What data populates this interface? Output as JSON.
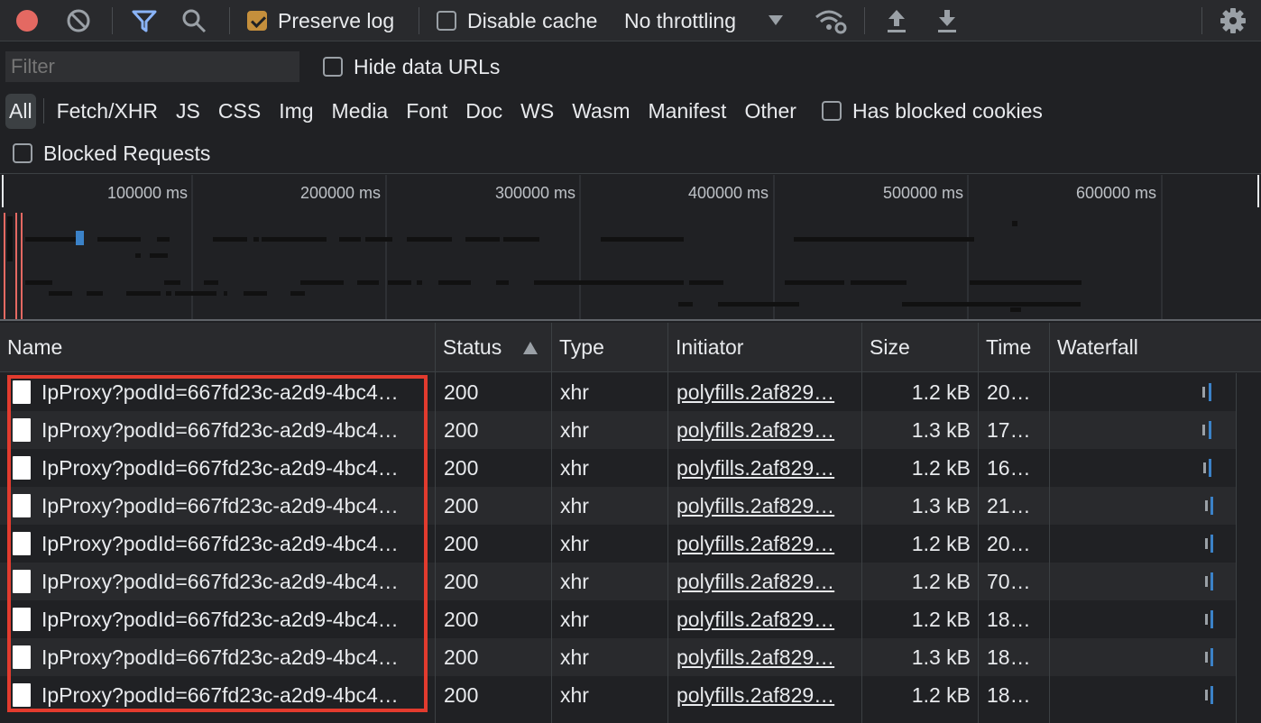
{
  "toolbar": {
    "preserve_log": "Preserve log",
    "disable_cache": "Disable cache",
    "throttling": "No throttling"
  },
  "filter": {
    "placeholder": "Filter",
    "hide_data_urls": "Hide data URLs",
    "types": [
      "All",
      "Fetch/XHR",
      "JS",
      "CSS",
      "Img",
      "Media",
      "Font",
      "Doc",
      "WS",
      "Wasm",
      "Manifest",
      "Other"
    ],
    "has_blocked_cookies": "Has blocked cookies",
    "blocked_requests": "Blocked Requests"
  },
  "overview": {
    "ticks": [
      "100000 ms",
      "200000 ms",
      "300000 ms",
      "400000 ms",
      "500000 ms",
      "600000 ms"
    ]
  },
  "table": {
    "headers": [
      "Name",
      "Status",
      "Type",
      "Initiator",
      "Size",
      "Time",
      "Waterfall"
    ],
    "rows": [
      {
        "name": "IpProxy?podId=667fd23c-a2d9-4bc4…",
        "status": "200",
        "type": "xhr",
        "initiator": "polyfills.2af829…",
        "size": "1.2 kB",
        "time": "20…"
      },
      {
        "name": "IpProxy?podId=667fd23c-a2d9-4bc4…",
        "status": "200",
        "type": "xhr",
        "initiator": "polyfills.2af829…",
        "size": "1.3 kB",
        "time": "17…"
      },
      {
        "name": "IpProxy?podId=667fd23c-a2d9-4bc4…",
        "status": "200",
        "type": "xhr",
        "initiator": "polyfills.2af829…",
        "size": "1.2 kB",
        "time": "16…"
      },
      {
        "name": "IpProxy?podId=667fd23c-a2d9-4bc4…",
        "status": "200",
        "type": "xhr",
        "initiator": "polyfills.2af829…",
        "size": "1.3 kB",
        "time": "21…"
      },
      {
        "name": "IpProxy?podId=667fd23c-a2d9-4bc4…",
        "status": "200",
        "type": "xhr",
        "initiator": "polyfills.2af829…",
        "size": "1.2 kB",
        "time": "20…"
      },
      {
        "name": "IpProxy?podId=667fd23c-a2d9-4bc4…",
        "status": "200",
        "type": "xhr",
        "initiator": "polyfills.2af829…",
        "size": "1.2 kB",
        "time": "70…"
      },
      {
        "name": "IpProxy?podId=667fd23c-a2d9-4bc4…",
        "status": "200",
        "type": "xhr",
        "initiator": "polyfills.2af829…",
        "size": "1.2 kB",
        "time": "18…"
      },
      {
        "name": "IpProxy?podId=667fd23c-a2d9-4bc4…",
        "status": "200",
        "type": "xhr",
        "initiator": "polyfills.2af829…",
        "size": "1.3 kB",
        "time": "18…"
      },
      {
        "name": "IpProxy?podId=667fd23c-a2d9-4bc4…",
        "status": "200",
        "type": "xhr",
        "initiator": "polyfills.2af829…",
        "size": "1.2 kB",
        "time": "18…"
      }
    ]
  }
}
